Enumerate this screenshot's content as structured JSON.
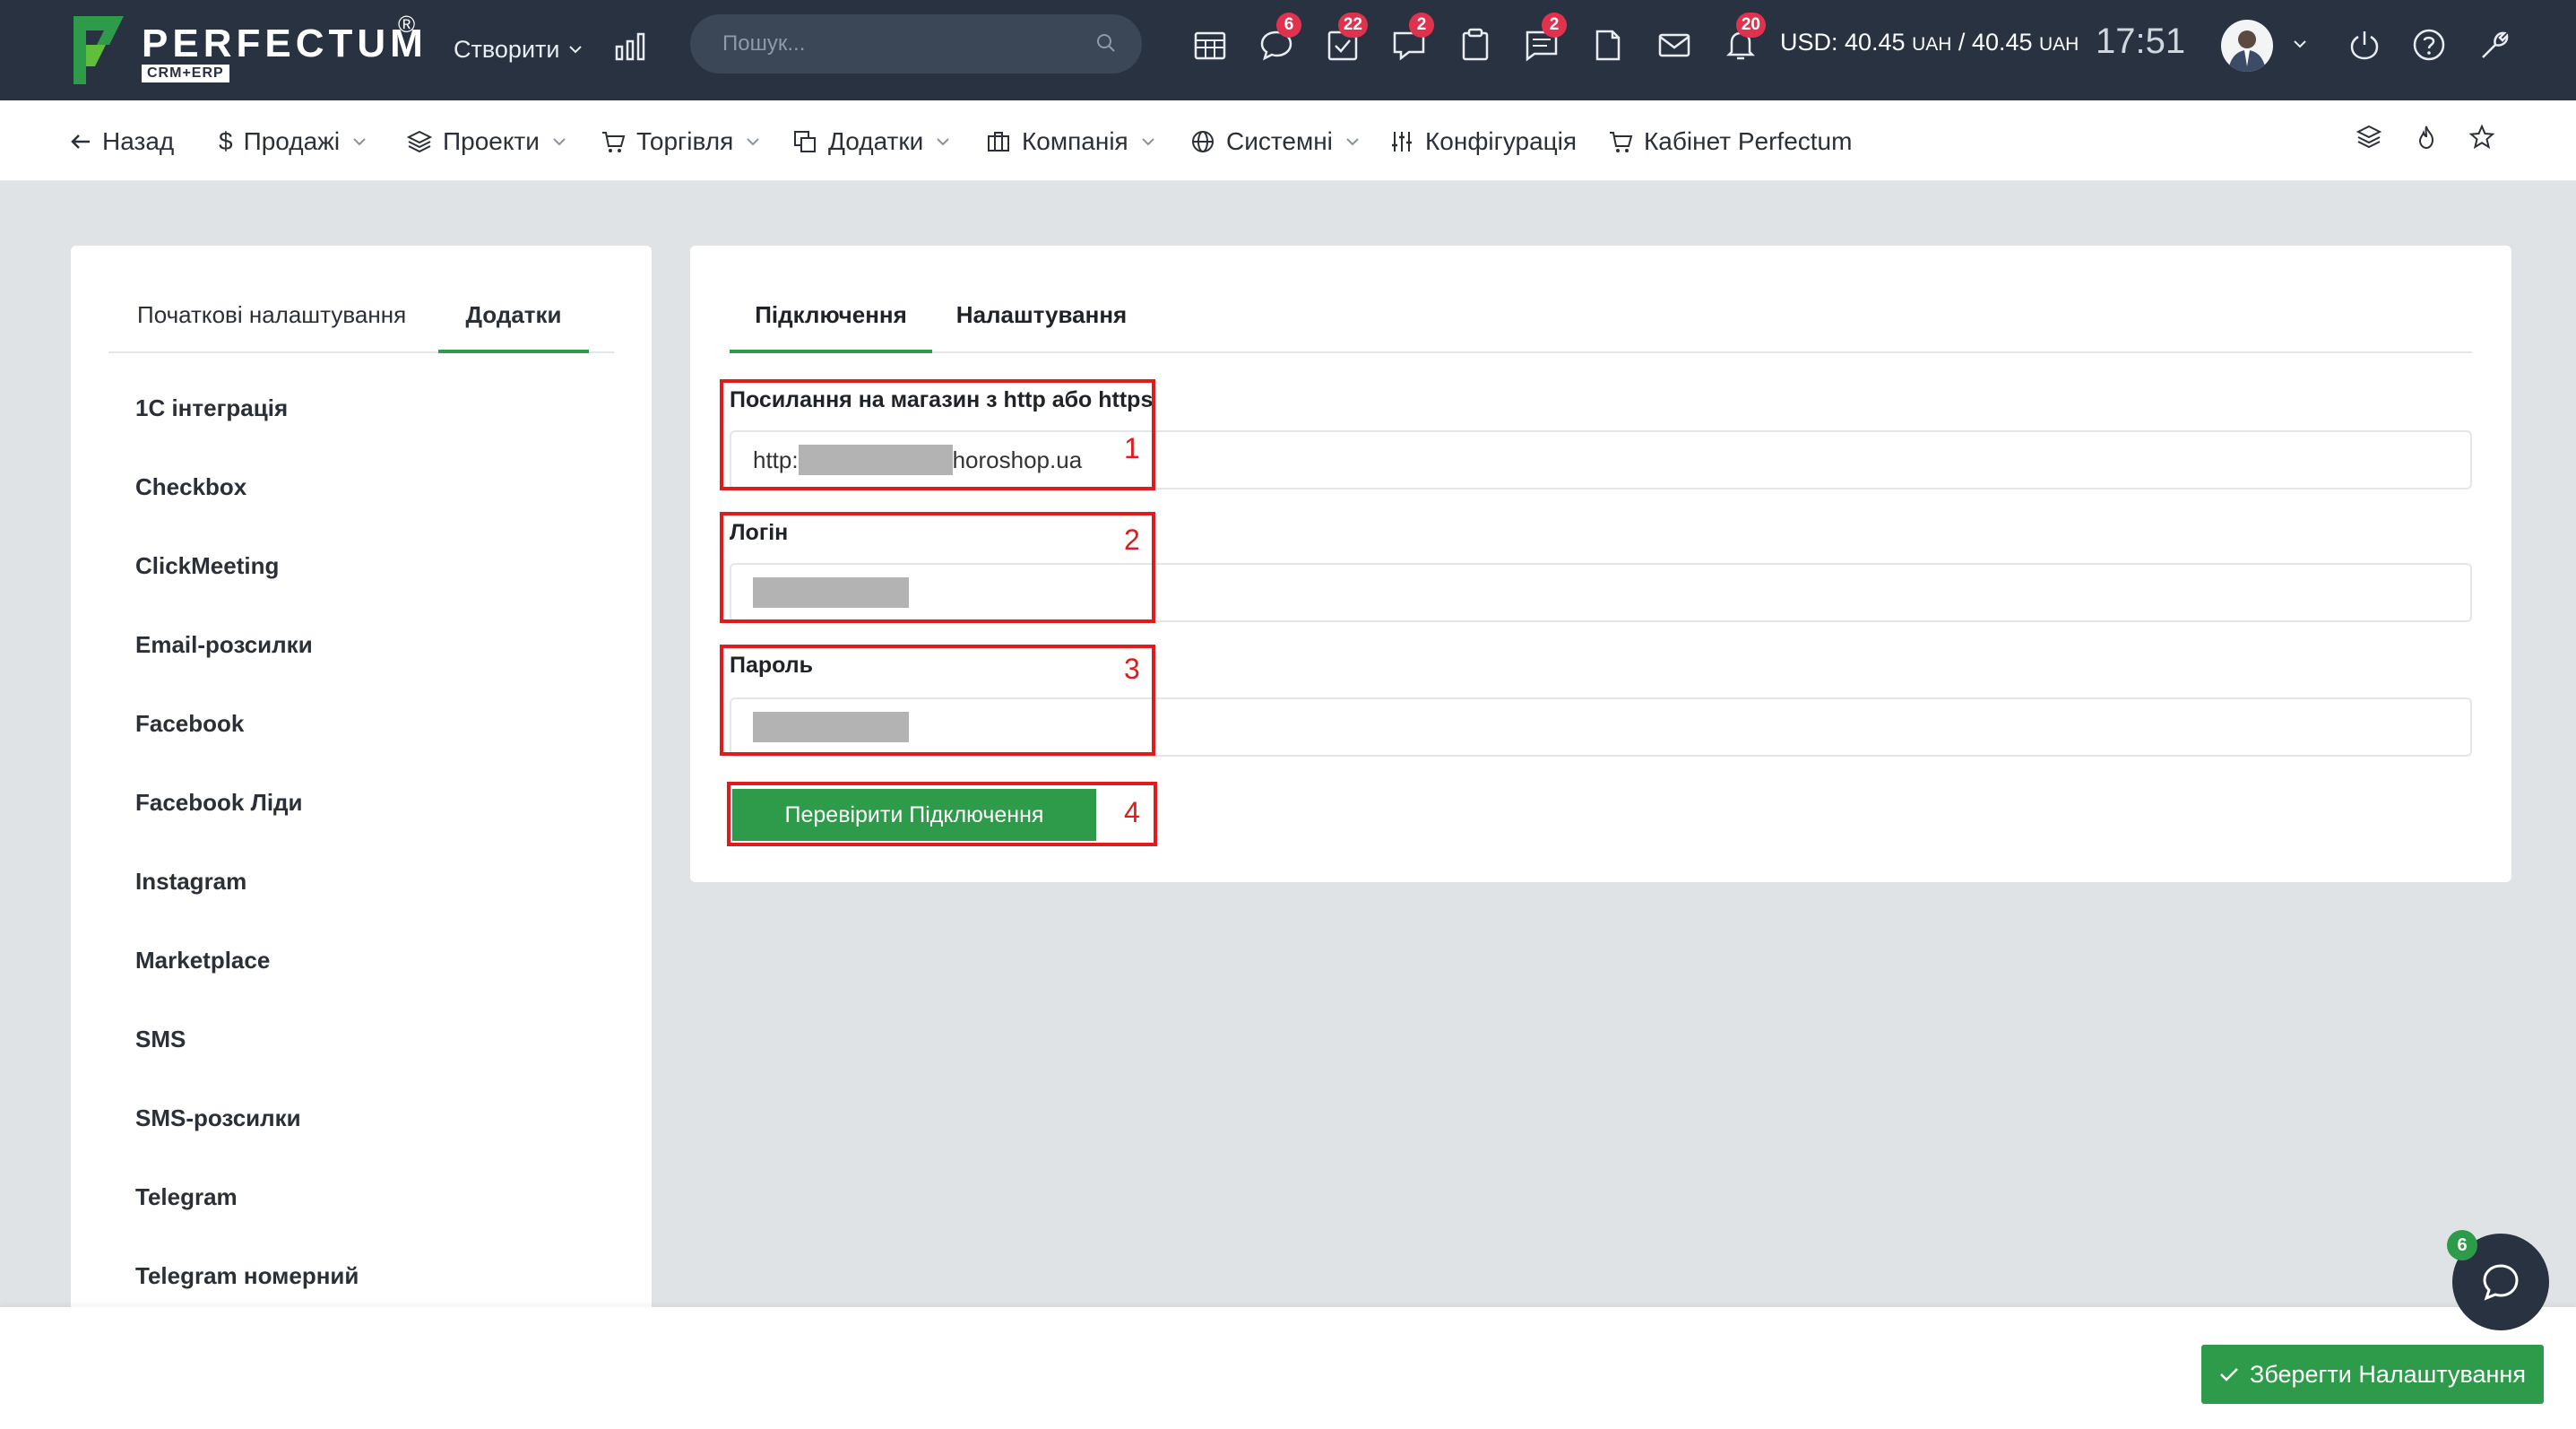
{
  "brand": {
    "name": "PERFECTUM",
    "sub": "CRM+ERP",
    "reg": "®"
  },
  "topbar": {
    "create_label": "Створити",
    "search_placeholder": "Пошук...",
    "badges": {
      "chat": "6",
      "tasks": "22",
      "support": "2",
      "notes": "2",
      "notifications": "20"
    },
    "currency": {
      "prefix": "USD: 40.45 ",
      "unit1": "UAH",
      "mid": " / 40.45 ",
      "unit2": "UAH"
    },
    "clock": "17:51"
  },
  "nav": {
    "back": "Назад",
    "sales": "Продажі",
    "projects": "Проекти",
    "trade": "Торгівля",
    "addons": "Додатки",
    "company": "Компанія",
    "system": "Системні",
    "config": "Конфігурація",
    "cabinet": "Кабінет Perfectum"
  },
  "left": {
    "tabs": [
      "Початкові налаштування",
      "Додатки"
    ],
    "items": [
      "1С інтеграція",
      "Checkbox",
      "ClickMeeting",
      "Email-розсилки",
      "Facebook",
      "Facebook Ліди",
      "Instagram",
      "Marketplace",
      "SMS",
      "SMS-розсилки",
      "Telegram",
      "Telegram номерний"
    ]
  },
  "right": {
    "tabs": [
      "Підключення",
      "Налаштування"
    ],
    "fields": {
      "url_label": "Посилання на магазин з http або https",
      "url_prefix": "http:",
      "url_suffix": "horoshop.ua",
      "login_label": "Логін",
      "password_label": "Пароль"
    },
    "check_button": "Перевірити Підключення",
    "markers": [
      "1",
      "2",
      "3",
      "4"
    ]
  },
  "footer": {
    "save_button": "Зберегти Налаштування",
    "chat_badge": "6"
  },
  "colors": {
    "topbar": "#283240",
    "accent": "#2d9b4a",
    "badge": "#e0324f",
    "annotation": "#e01b1b"
  }
}
